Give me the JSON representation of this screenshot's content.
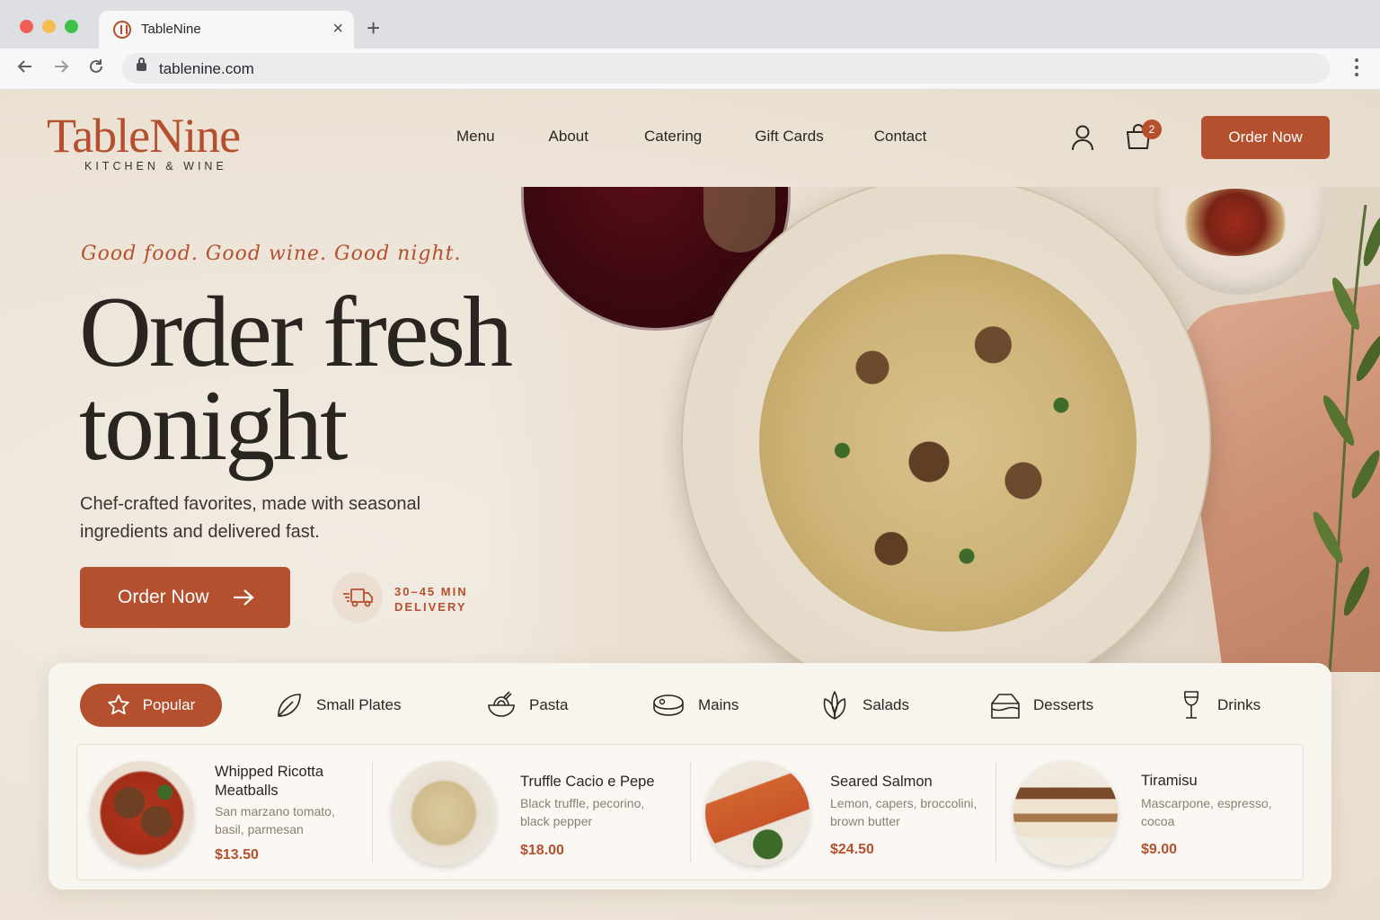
{
  "browser": {
    "tab_title": "TableNine",
    "new_tab": "+",
    "close": "×",
    "url": "tablenine.com"
  },
  "brand": {
    "name": "TableNine",
    "subtitle": "KITCHEN & WINE",
    "accent_color": "#b5502f"
  },
  "nav": {
    "items": [
      "Menu",
      "About",
      "Catering",
      "Gift Cards",
      "Contact"
    ],
    "cart_count": "2",
    "order_label": "Order Now"
  },
  "hero": {
    "tagline": "Good food.  Good wine.  Good night.",
    "headline_line1": "Order fresh",
    "headline_line2": "tonight",
    "subtext": "Chef-crafted favorites, made with seasonal ingredients and delivered fast.",
    "cta_label": "Order Now",
    "delivery_line1": "30–45 MIN",
    "delivery_line2": "DELIVERY"
  },
  "categories": [
    {
      "label": "Popular",
      "icon": "star-icon",
      "active": true
    },
    {
      "label": "Small Plates",
      "icon": "leaf-icon"
    },
    {
      "label": "Pasta",
      "icon": "pasta-bowl-icon"
    },
    {
      "label": "Mains",
      "icon": "steak-icon"
    },
    {
      "label": "Salads",
      "icon": "salad-leaves-icon"
    },
    {
      "label": "Desserts",
      "icon": "cake-icon"
    },
    {
      "label": "Drinks",
      "icon": "wine-glass-icon"
    }
  ],
  "dishes": [
    {
      "name": "Whipped Ricotta Meatballs",
      "description": "San marzano tomato, basil, parmesan",
      "price": "$13.50"
    },
    {
      "name": "Truffle Cacio e Pepe",
      "description": "Black truffle, pecorino, black pepper",
      "price": "$18.00"
    },
    {
      "name": "Seared Salmon",
      "description": "Lemon, capers, broccolini, brown butter",
      "price": "$24.50"
    },
    {
      "name": "Tiramisu",
      "description": "Mascarpone, espresso, cocoa",
      "price": "$9.00"
    }
  ]
}
